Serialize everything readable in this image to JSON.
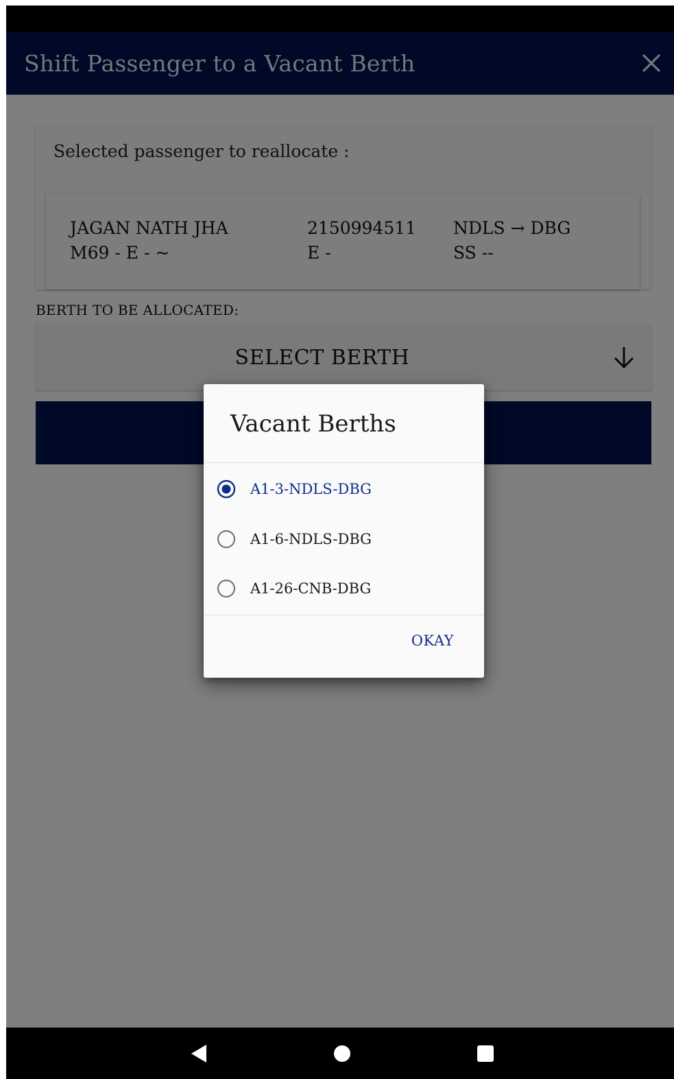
{
  "app_bar": {
    "title": "Shift Passenger to a Vacant Berth",
    "close_icon": "close-icon"
  },
  "passenger_card": {
    "heading": "Selected passenger to reallocate :",
    "name": "JAGAN NATH JHA",
    "details": "M69 - E - ~",
    "pnr": "2150994511",
    "pnr_sub": "E -",
    "route": "NDLS → DBG",
    "route_sub": "SS --"
  },
  "berth": {
    "label": "BERTH TO BE ALLOCATED:",
    "select_text": "SELECT BERTH",
    "arrow_icon": "arrow-down-icon"
  },
  "dialog": {
    "title": "Vacant Berths",
    "options": [
      {
        "label": "A1-3-NDLS-DBG",
        "selected": true
      },
      {
        "label": "A1-6-NDLS-DBG",
        "selected": false
      },
      {
        "label": "A1-26-CNB-DBG",
        "selected": false
      }
    ],
    "okay_label": "OKAY"
  },
  "colors": {
    "primary": "#001350",
    "accent": "#0d2f8a"
  },
  "nav": {
    "icons": [
      "back-icon",
      "home-icon",
      "recents-icon"
    ]
  }
}
